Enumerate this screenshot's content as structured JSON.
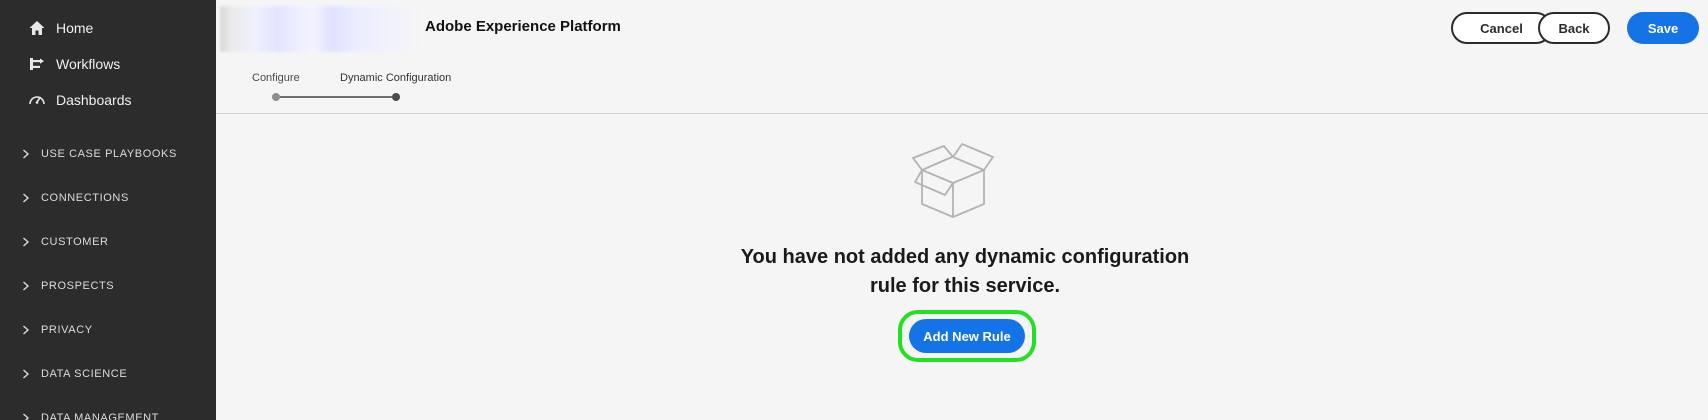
{
  "sidebar": {
    "top_items": [
      {
        "label": "Home",
        "icon": "home-icon"
      },
      {
        "label": "Workflows",
        "icon": "workflows-icon"
      },
      {
        "label": "Dashboards",
        "icon": "dashboard-gauge-icon"
      }
    ],
    "sections": [
      {
        "label": "USE CASE PLAYBOOKS"
      },
      {
        "label": "CONNECTIONS"
      },
      {
        "label": "CUSTOMER"
      },
      {
        "label": "PROSPECTS"
      },
      {
        "label": "PRIVACY"
      },
      {
        "label": "DATA SCIENCE"
      },
      {
        "label": "DATA MANAGEMENT"
      }
    ]
  },
  "header": {
    "app_title": "Adobe Experience Platform",
    "cancel_label": "Cancel",
    "back_label": "Back",
    "save_label": "Save"
  },
  "stepper": {
    "steps": [
      {
        "label": "Configure"
      },
      {
        "label": "Dynamic Configuration"
      }
    ],
    "current_step": 2
  },
  "empty_state": {
    "icon": "open-box-icon",
    "message": "You have not added any dynamic configuration rule for this service.",
    "add_button_label": "Add New Rule"
  },
  "colors": {
    "sidebar_bg": "#2c2c2c",
    "primary": "#1473e6",
    "highlight": "#22e022",
    "page_bg": "#f5f5f5"
  }
}
